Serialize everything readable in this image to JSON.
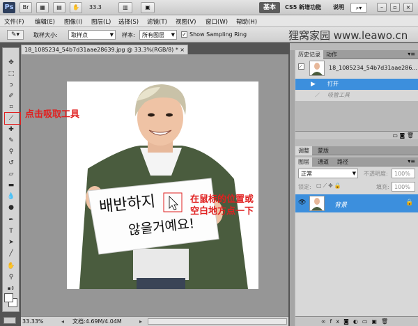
{
  "titlebar": {
    "logo": "Ps",
    "zoom": "33.3",
    "workspace_basic": "基本",
    "workspace_cs5": "CS5 新增功能",
    "help_link": "说明"
  },
  "menu": [
    "文件(F)",
    "编辑(E)",
    "图像(I)",
    "图层(L)",
    "选择(S)",
    "滤镜(T)",
    "视图(V)",
    "窗口(W)",
    "帮助(H)"
  ],
  "options": {
    "sample_size_label": "取样大小:",
    "sample_size_value": "取样点",
    "sample_label": "样本:",
    "sample_value": "所有图层",
    "show_ring_label": "Show Sampling Ring"
  },
  "watermark": "狸窝家园 www.leawo.cn",
  "document": {
    "tab_title": "18_1085234_54b7d31aae28639.jpg @ 33.3%(RGB/8) *",
    "sign_line1": "배반하지",
    "sign_line2": "않을거예요!"
  },
  "status": {
    "zoom": "33.33%",
    "doc_info": "文档:4.69M/4.04M"
  },
  "history_panel": {
    "tabs": [
      "历史记录",
      "动作"
    ],
    "snapshot_name": "18_1085234_54b7d31aae286...",
    "rows": [
      "打开",
      "吸管工具"
    ]
  },
  "adjust_panel": {
    "tabs": [
      "调整",
      "蒙版"
    ]
  },
  "layers_panel": {
    "tabs": [
      "图层",
      "通道",
      "路径"
    ],
    "blend_mode": "正常",
    "opacity_label": "不透明度:",
    "opacity_value": "100%",
    "lock_label": "锁定:",
    "fill_label": "填充:",
    "fill_value": "100%",
    "layer_name": "背景"
  },
  "annotations": {
    "click_eyedropper": "点击吸取工具",
    "click_blank_line1": "在鼠标的位置或",
    "click_blank_line2": "空白地方点一下"
  },
  "colors": {
    "annotation_red": "#e02020",
    "selection_blue": "#3c8fdd",
    "canvas_bg": "#969696"
  }
}
